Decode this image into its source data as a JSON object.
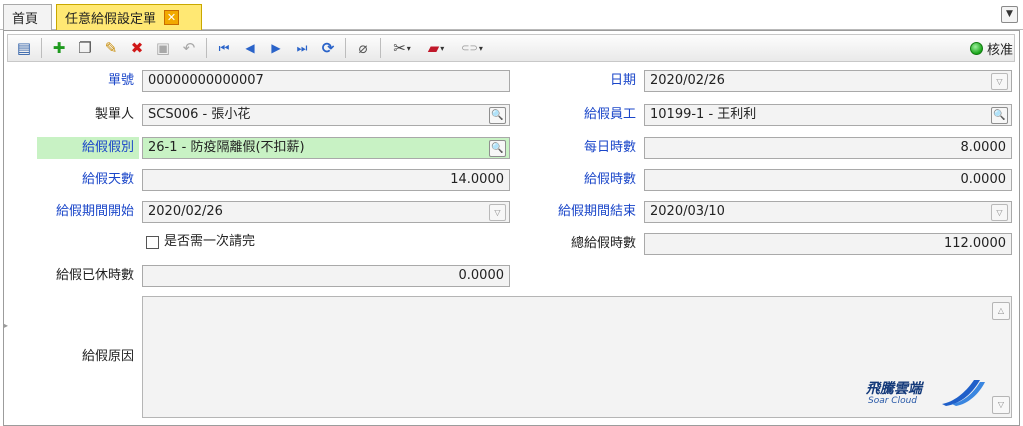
{
  "tabs": {
    "home": "首頁",
    "active": "任意給假設定單",
    "close_glyph": "✕"
  },
  "toolbar": {
    "icons": {
      "panel": "▤",
      "add": "✚",
      "copy": "❐",
      "edit": "✎",
      "delete": "✖",
      "save": "▣",
      "undo": "↶",
      "first": "⏮",
      "prev": "◀",
      "next": "▶",
      "last": "⏭",
      "refresh": "⟳",
      "attach": "⌀",
      "tools": "✂",
      "toolbox": "▰",
      "link": "⊂⊃",
      "caret": "▾"
    },
    "approve_label": "核准"
  },
  "form": {
    "doc_no": {
      "label": "單號",
      "value": "00000000000007"
    },
    "date": {
      "label": "日期",
      "value": "2020/02/26"
    },
    "creator": {
      "label": "製單人",
      "value": "SCS006 - 張小花"
    },
    "employee": {
      "label": "給假員工",
      "value": "10199-1 - 王利利"
    },
    "leave_type": {
      "label": "給假假別",
      "value": "26-1 - 防疫隔離假(不扣薪)"
    },
    "daily_hours": {
      "label": "每日時數",
      "value": "8.0000"
    },
    "leave_days": {
      "label": "給假天數",
      "value": "14.0000"
    },
    "leave_hours": {
      "label": "給假時數",
      "value": "0.0000"
    },
    "period_start": {
      "label": "給假期間開始",
      "value": "2020/02/26"
    },
    "period_end": {
      "label": "給假期間結束",
      "value": "2020/03/10"
    },
    "one_time": {
      "label": "是否需一次請完",
      "checked": false
    },
    "total_hours": {
      "label": "總給假時數",
      "value": "112.0000"
    },
    "used_hours": {
      "label": "給假已休時數",
      "value": "0.0000"
    },
    "reason": {
      "label": "給假原因",
      "value": ""
    }
  },
  "logo": {
    "name": "飛騰雲端",
    "sub": "Soar Cloud"
  },
  "colors": {
    "label_blue": "#1a46c9",
    "highlight_green": "#c8f2c4",
    "active_tab": "#ffe873"
  }
}
